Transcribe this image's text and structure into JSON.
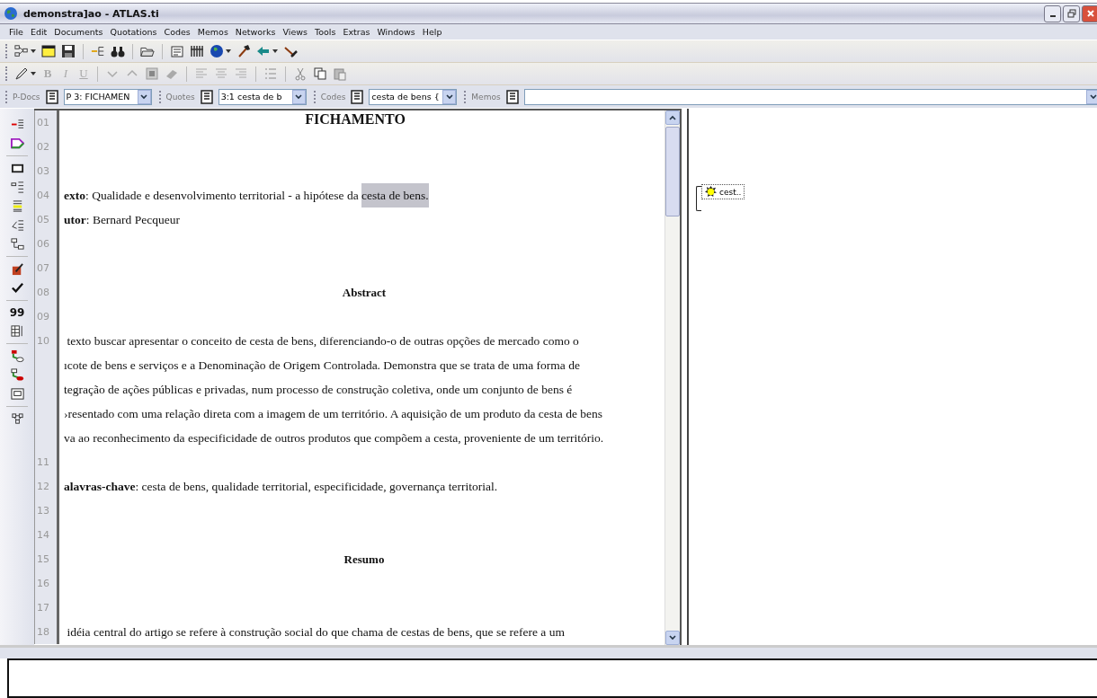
{
  "window": {
    "title": "demonstra]ao - ATLAS.ti"
  },
  "menu": [
    "File",
    "Edit",
    "Documents",
    "Quotations",
    "Codes",
    "Memos",
    "Networks",
    "Views",
    "Tools",
    "Extras",
    "Windows",
    "Help"
  ],
  "format_toolbar": [
    {
      "text": "B",
      "kind": "bold",
      "disabled": true
    },
    {
      "text": "I",
      "kind": "italic",
      "disabled": true
    },
    {
      "text": "U",
      "kind": "underline",
      "disabled": true
    }
  ],
  "navigator": [
    {
      "label": "P-Docs",
      "value": "P 3: FICHAMEN",
      "kind": "combo"
    },
    {
      "label": "Quotes",
      "value": "3:1 cesta de b",
      "kind": "combo"
    },
    {
      "label": "Codes",
      "value": "cesta de bens {",
      "kind": "combo"
    },
    {
      "label": "Memos",
      "kind": "wide"
    }
  ],
  "side_toolbar": [
    {
      "kind": "quote-count",
      "text": "99"
    }
  ],
  "document": {
    "lines": [
      {
        "num": "01",
        "kind": "heading",
        "text": "FICHAMENTO"
      },
      {
        "num": "02",
        "kind": "empty"
      },
      {
        "num": "03",
        "kind": "empty"
      },
      {
        "num": "04",
        "kind": "text",
        "text": "**exto**: Qualidade e desenvolvimento territorial - a hipótese da ",
        "quotation": "cesta de bens."
      },
      {
        "num": "05",
        "kind": "text",
        "text": "**utor**: Bernard Pecqueur"
      },
      {
        "num": "06",
        "kind": "empty"
      },
      {
        "num": "07",
        "kind": "empty"
      },
      {
        "num": "08",
        "kind": "subheading",
        "text": "Abstract"
      },
      {
        "num": "09",
        "kind": "empty"
      },
      {
        "num": "10",
        "kind": "paragraph",
        "lines": [
          " texto buscar apresentar o conceito de cesta de bens, diferenciando-o de outras opções de mercado como o",
          "ıcote de bens e serviços e a Denominação de Origem Controlada. Demonstra que se trata de uma forma de",
          "tegração de ações públicas e privadas, num processo de construção coletiva, onde um conjunto de bens é",
          "›resentado com uma relação direta com a imagem de um território. A aquisição de um produto da cesta de bens",
          "va ao reconhecimento da especificidade de outros produtos que compõem a cesta, proveniente de um território."
        ]
      },
      {
        "num": "11",
        "kind": "empty"
      },
      {
        "num": "12",
        "kind": "text",
        "text": "**alavras-chave**: cesta de bens, qualidade territorial, especificidade, governança territorial."
      },
      {
        "num": "13",
        "kind": "empty"
      },
      {
        "num": "14",
        "kind": "empty"
      },
      {
        "num": "15",
        "kind": "subheading",
        "text": "Resumo"
      },
      {
        "num": "16",
        "kind": "empty"
      },
      {
        "num": "17",
        "kind": "empty"
      },
      {
        "num": "18",
        "kind": "text",
        "text": " idéia central do artigo se refere à construção social do que chama de cestas de bens, que se refere a um"
      }
    ]
  },
  "margin": {
    "codes": [
      {
        "label": "cest.."
      }
    ]
  }
}
